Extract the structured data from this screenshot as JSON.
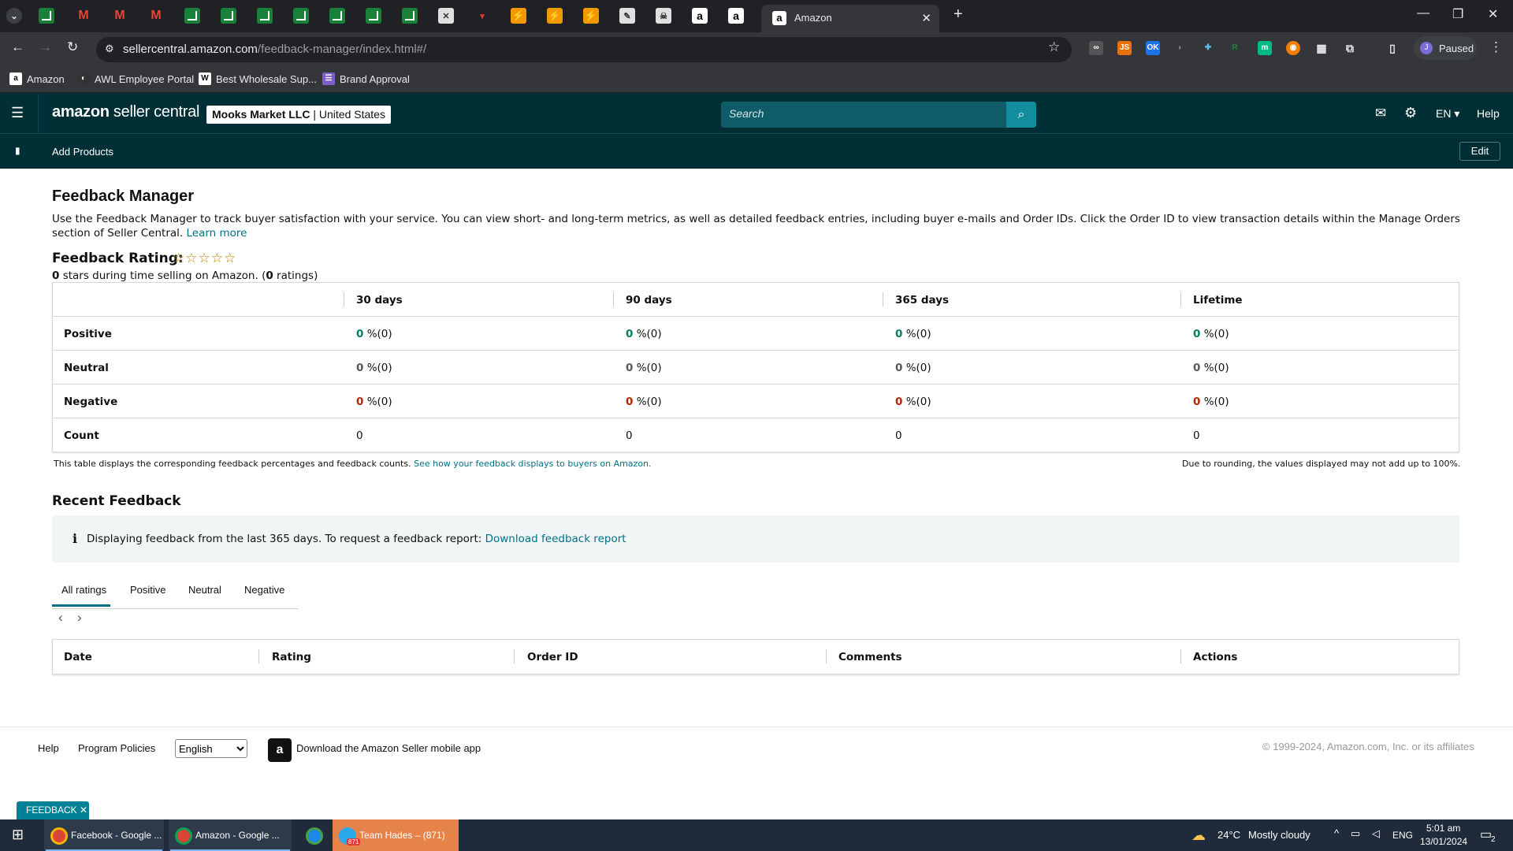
{
  "browser": {
    "active_tab_title": "Amazon",
    "url_host": "sellercentral.amazon.com",
    "url_path": "/feedback-manager/index.html#/",
    "profile_status": "Paused",
    "profile_initial": "J",
    "bookmarks": [
      "Amazon",
      "AWL Employee Portal",
      "Best Wholesale Sup...",
      "Brand Approval"
    ]
  },
  "header": {
    "logo_bold": "amazon",
    "logo_rest": " seller central",
    "store_name": "Mooks Market LLC",
    "store_region": "United States",
    "search_placeholder": "Search",
    "language": "EN",
    "help": "Help",
    "shortcut": "Add Products",
    "edit": "Edit"
  },
  "page": {
    "title": "Feedback Manager",
    "intro": "Use the Feedback Manager to track buyer satisfaction with your service. You can view short- and long-term metrics, as well as detailed feedback entries, including buyer e-mails and Order IDs. Click the Order ID to view transaction details within the Manage Orders section of Seller Central.",
    "learn_more": "Learn more",
    "rating_label": "Feedback Rating:",
    "rating_stars": "☆☆☆☆☆",
    "rating_value": "0",
    "rating_text_a": " stars during time selling on Amazon. (",
    "rating_count": "0",
    "rating_text_b": " ratings)"
  },
  "metrics": {
    "columns": [
      "30 days",
      "90 days",
      "365 days",
      "Lifetime"
    ],
    "rows": [
      {
        "label": "Positive",
        "values": [
          "0",
          "0",
          "0",
          "0"
        ],
        "suffix": "%(0)"
      },
      {
        "label": "Neutral",
        "values": [
          "0",
          "0",
          "0",
          "0"
        ],
        "suffix": "%(0)"
      },
      {
        "label": "Negative",
        "values": [
          "0",
          "0",
          "0",
          "0"
        ],
        "suffix": "%(0)"
      },
      {
        "label": "Count",
        "values": [
          "0",
          "0",
          "0",
          "0"
        ],
        "suffix": ""
      }
    ],
    "note": "This table displays the corresponding feedback percentages and feedback counts.",
    "note_link": "See how your feedback displays to buyers on Amazon.",
    "rounding_note": "Due to rounding, the values displayed may not add up to 100%."
  },
  "recent": {
    "title": "Recent Feedback",
    "info_text": "Displaying feedback from the last 365 days. To request a feedback report:",
    "info_link": "Download feedback report",
    "tabs": [
      "All ratings",
      "Positive",
      "Neutral",
      "Negative"
    ],
    "active_tab": "All ratings",
    "columns": [
      "Date",
      "Rating",
      "Order ID",
      "Comments",
      "Actions"
    ]
  },
  "footer": {
    "help": "Help",
    "policies": "Program Policies",
    "language": "English",
    "app_text": "Download the Amazon Seller mobile app",
    "copyright": "© 1999-2024, Amazon.com, Inc. or its affiliates",
    "feedback_tab": "FEEDBACK"
  },
  "taskbar": {
    "apps": [
      "Facebook - Google ...",
      "Amazon - Google ...",
      "Team Hades – (871)"
    ],
    "telegram_badge": "871",
    "weather_temp": "24°C",
    "weather_text": "Mostly cloudy",
    "lang": "ENG",
    "time": "5:01 am",
    "date": "13/01/2024",
    "notif_count": "2"
  },
  "colors": {
    "header_bg": "#002f36",
    "link": "#007185",
    "positive": "#067d62",
    "negative": "#b12704"
  }
}
